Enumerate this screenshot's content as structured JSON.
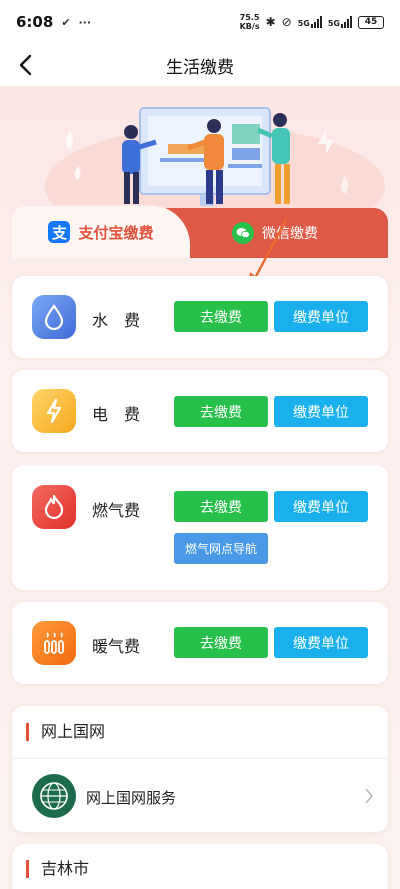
{
  "status_bar": {
    "time": "6:08",
    "speed_value": "75.5",
    "speed_unit": "KB/s",
    "net1": "5G",
    "net2": "5G",
    "battery": "45"
  },
  "header": {
    "title": "生活缴费"
  },
  "tabs": [
    {
      "label": "支付宝缴费",
      "icon": "alipay-icon",
      "selected": true
    },
    {
      "label": "微信缴费",
      "icon": "wechat-icon",
      "selected": false
    }
  ],
  "bills": [
    {
      "label": "水　费",
      "icon": "water-drop-icon",
      "pay": "去缴费",
      "unit": "缴费单位"
    },
    {
      "label": "电　费",
      "icon": "lightning-icon",
      "pay": "去缴费",
      "unit": "缴费单位"
    },
    {
      "label": "燃气费",
      "icon": "flame-icon",
      "pay": "去缴费",
      "unit": "缴费单位",
      "extra": "燃气网点导航"
    },
    {
      "label": "暖气费",
      "icon": "heater-icon",
      "pay": "去缴费",
      "unit": "缴费单位"
    }
  ],
  "sections": [
    {
      "title": "网上国网",
      "items": [
        {
          "label": "网上国网服务",
          "icon": "state-grid-icon"
        }
      ]
    },
    {
      "title": "吉林市"
    }
  ],
  "colors": {
    "accent": "#de5a47",
    "pay_button": "#26c04a",
    "unit_button": "#1ab0ee",
    "nav_button": "#4a98e8"
  }
}
